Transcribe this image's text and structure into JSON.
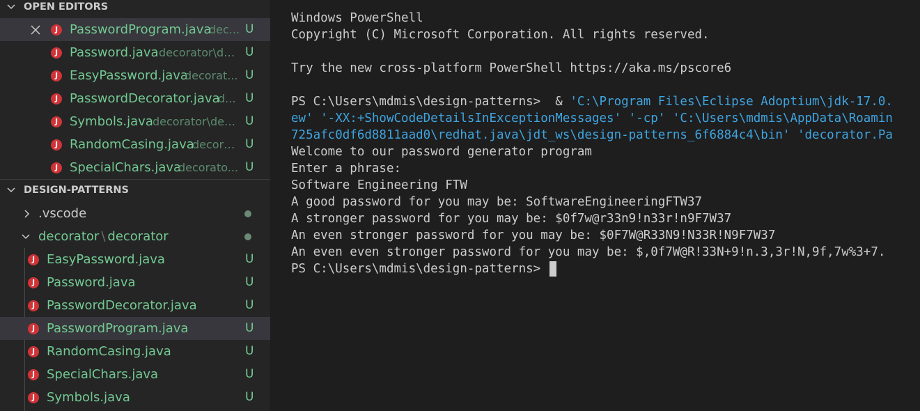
{
  "explorer": {
    "open_editors": {
      "title": "OPEN EDITORS",
      "items": [
        {
          "name": "PasswordProgram.java",
          "description": "dec...",
          "status": "U"
        },
        {
          "name": "Password.java",
          "description": "decorator\\de...",
          "status": "U"
        },
        {
          "name": "EasyPassword.java",
          "description": "decorat...",
          "status": "U"
        },
        {
          "name": "PasswordDecorator.java",
          "description": "d...",
          "status": "U"
        },
        {
          "name": "Symbols.java",
          "description": "decorator\\dec...",
          "status": "U"
        },
        {
          "name": "RandomCasing.java",
          "description": "decora...",
          "status": "U"
        },
        {
          "name": "SpecialChars.java",
          "description": "decorato...",
          "status": "U"
        }
      ]
    },
    "workspace": {
      "title": "DESIGN-PATTERNS",
      "folders": [
        {
          "name": ".vscode"
        },
        {
          "name_part1": "decorator",
          "separator": "\\",
          "name_part2": "decorator"
        }
      ],
      "files": [
        {
          "name": "EasyPassword.java",
          "status": "U"
        },
        {
          "name": "Password.java",
          "status": "U"
        },
        {
          "name": "PasswordDecorator.java",
          "status": "U"
        },
        {
          "name": "PasswordProgram.java",
          "status": "U"
        },
        {
          "name": "RandomCasing.java",
          "status": "U"
        },
        {
          "name": "SpecialChars.java",
          "status": "U"
        },
        {
          "name": "Symbols.java",
          "status": "U"
        }
      ]
    },
    "java_icon_letter": "J"
  },
  "terminal": {
    "lines": [
      "Windows PowerShell",
      "Copyright (C) Microsoft Corporation. All rights reserved.",
      "",
      "Try the new cross-platform PowerShell https://aka.ms/pscore6",
      ""
    ],
    "command": {
      "prompt": "PS C:\\Users\\mdmis\\design-patterns>  & ",
      "line1_arg": "'C:\\Program Files\\Eclipse Adoptium\\jdk-17.0.",
      "line2": "ew' '-XX:+ShowCodeDetailsInExceptionMessages' '-cp' 'C:\\Users\\mdmis\\AppData\\Roamin",
      "line3": "725afc0df6d8811aad0\\redhat.java\\jdt_ws\\design-patterns_6f6884c4\\bin' 'decorator.Pa"
    },
    "output": [
      "Welcome to our password generator program",
      "Enter a phrase:",
      "Software Engineering FTW",
      "A good password for you may be: SoftwareEngineeringFTW37",
      "A stronger password for you may be: $0f7w@r33n9!n33r!n9F7W37",
      "An even stronger password for you may be: $0F7W@R33N9!N33R!N9F7W37",
      "An even even stronger password for you may be: $,0f7W@R!33N+9!n.3,3r!N,9f,7w%3+7."
    ],
    "final_prompt": "PS C:\\Users\\mdmis\\design-patterns> "
  }
}
